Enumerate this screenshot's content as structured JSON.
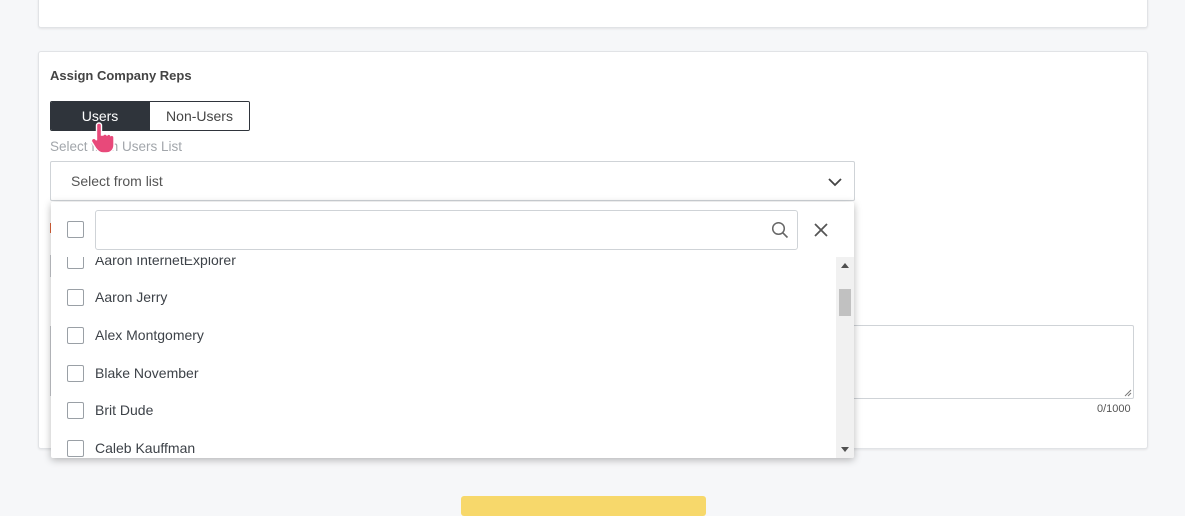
{
  "section": {
    "title": "Assign Company Reps"
  },
  "toggle": {
    "users_label": "Users",
    "non_users_label": "Non-Users"
  },
  "select": {
    "label": "Select from Users List",
    "placeholder": "Select from list"
  },
  "dropdown": {
    "search_value": "",
    "items": [
      {
        "label": "Aaron InternetExplorer",
        "checked": false
      },
      {
        "label": "Aaron Jerry",
        "checked": false
      },
      {
        "label": "Alex Montgomery",
        "checked": false
      },
      {
        "label": "Blake November",
        "checked": false
      },
      {
        "label": "Brit Dude",
        "checked": false
      },
      {
        "label": "Caleb Kauffman",
        "checked": false
      }
    ]
  },
  "notes": {
    "char_count": "0/1000"
  },
  "colors": {
    "toggle_active_bg": "#2f343b",
    "submit_button": "#f7d86b",
    "pointer_hand": "#e8497a"
  },
  "icons": {
    "chevron": "chevron-down-icon",
    "search": "search-icon",
    "close": "close-icon",
    "pointer": "hand-pointer-icon"
  }
}
